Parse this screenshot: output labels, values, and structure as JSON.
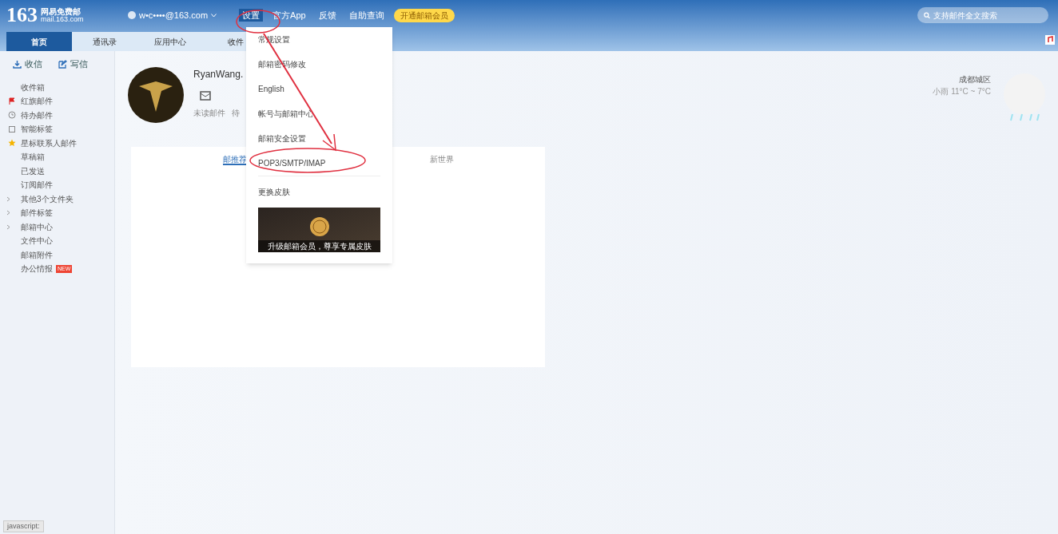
{
  "header": {
    "logo_number": "163",
    "logo_title": "网易免费邮",
    "logo_domain": "mail.163.com",
    "account": "w•c••••@163.com",
    "nav": [
      {
        "label": "设置",
        "selected": true
      },
      {
        "label": "官方App",
        "selected": false
      },
      {
        "label": "反馈",
        "selected": false
      },
      {
        "label": "自助查询",
        "selected": false
      }
    ],
    "vip_badge": "开通邮箱会员",
    "search": {
      "placeholder": "支持邮件全文搜索"
    }
  },
  "tabs": [
    {
      "label": "首页",
      "selected": true
    },
    {
      "label": "通讯录",
      "selected": false
    },
    {
      "label": "应用中心",
      "selected": false
    },
    {
      "label": "收件",
      "selected": false
    }
  ],
  "sidebar": {
    "receive": "收信",
    "write": "写信",
    "items": [
      {
        "label": "收件箱",
        "kind": "plain"
      },
      {
        "label": "红旗邮件",
        "kind": "flag"
      },
      {
        "label": "待办邮件",
        "kind": "clock"
      },
      {
        "label": "智能标签",
        "kind": "tag"
      },
      {
        "label": "星标联系人邮件",
        "kind": "star"
      },
      {
        "label": "草稿箱",
        "kind": "plain"
      },
      {
        "label": "已发送",
        "kind": "plain"
      },
      {
        "label": "订阅邮件",
        "kind": "plain"
      },
      {
        "label": "其他3个文件夹",
        "kind": "group"
      },
      {
        "label": "邮件标签",
        "kind": "group"
      },
      {
        "label": "邮箱中心",
        "kind": "group"
      },
      {
        "label": "文件中心",
        "kind": "plain"
      },
      {
        "label": "邮箱附件",
        "kind": "plain"
      },
      {
        "label": "办公情报",
        "kind": "plain",
        "badge": "NEW"
      }
    ]
  },
  "profile": {
    "name": "RyanWang.",
    "stats": [
      "未读邮件",
      "待"
    ]
  },
  "feed": {
    "tabs": [
      {
        "label": "邮推荐",
        "selected": true
      },
      {
        "label": "新世界",
        "selected": false
      }
    ]
  },
  "weather": {
    "city": "成都城区",
    "forecast": "小雨 11°C ~ 7°C"
  },
  "settings_menu": {
    "items": [
      "常规设置",
      "邮箱密码修改",
      "English",
      "帐号与邮箱中心",
      "邮箱安全设置",
      "POP3/SMTP/IMAP",
      "更换皮肤"
    ],
    "banner": "升级邮箱会员，尊享专属皮肤"
  },
  "status_bar": "javascript:"
}
